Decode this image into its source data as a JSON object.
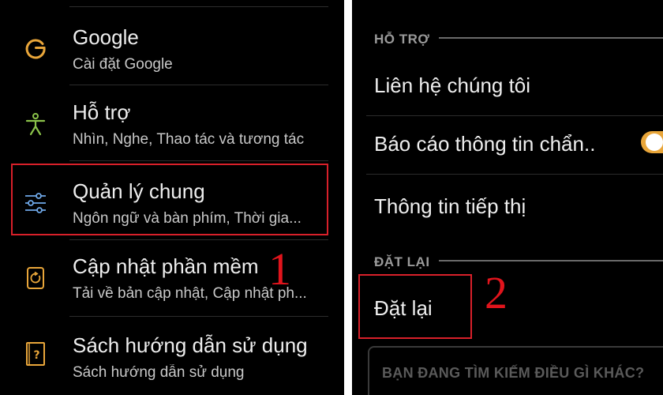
{
  "left_panel": {
    "items": [
      {
        "icon": "google-g-icon",
        "title": "Google",
        "subtitle": "Cài đặt Google"
      },
      {
        "icon": "accessibility-icon",
        "title": "Hỗ trợ",
        "subtitle": "Nhìn, Nghe, Thao tác và tương tác"
      },
      {
        "icon": "sliders-icon",
        "title": "Quản lý chung",
        "subtitle": "Ngôn ngữ và bàn phím, Thời gia..."
      },
      {
        "icon": "software-update-icon",
        "title": "Cập nhật phần mềm",
        "subtitle": "Tải về bản cập nhật, Cập nhật ph..."
      },
      {
        "icon": "user-manual-icon",
        "title": "Sách hướng dẫn sử dụng",
        "subtitle": "Sách hướng dẫn sử dụng"
      }
    ],
    "annotation": "1"
  },
  "right_panel": {
    "section_support": "HỖ TRỢ",
    "contact_us": "Liên hệ chúng tôi",
    "diagnostics": "Báo cáo thông tin chẩn..",
    "diagnostics_toggle_on": true,
    "marketing": "Thông tin tiếp thị",
    "section_reset": "ĐẶT LẠI",
    "reset": "Đặt lại",
    "annotation": "2",
    "search_placeholder": "BẠN ĐANG TÌM KIẾM ĐIỀU GÌ KHÁC?"
  },
  "colors": {
    "accent_orange": "#e9a63a",
    "highlight_red": "#d8202a",
    "icon_google": "#e9a63a",
    "icon_accessibility": "#8bc34a",
    "icon_sliders": "#6fa8e8",
    "icon_update": "#e9a63a",
    "icon_manual": "#e9a63a"
  }
}
